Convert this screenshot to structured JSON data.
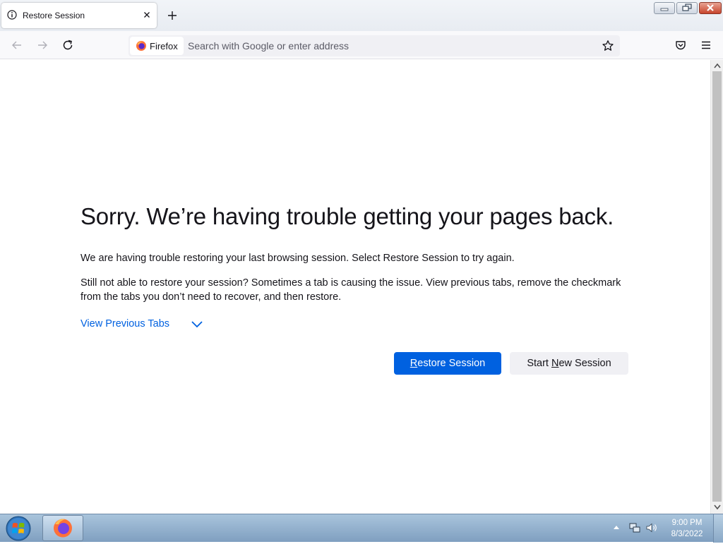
{
  "tab": {
    "title": "Restore Session",
    "icon": "info-icon"
  },
  "nav": {
    "identity_label": "Firefox",
    "url_placeholder": "Search with Google or enter address",
    "url_value": ""
  },
  "content": {
    "heading": "Sorry. We’re having trouble getting your pages back.",
    "paragraph1": "We are having trouble restoring your last browsing session. Select Restore Session to try again.",
    "paragraph2": "Still not able to restore your session? Sometimes a tab is causing the issue. View previous tabs, remove the checkmark from the tabs you don’t need to recover, and then restore.",
    "view_tabs_label": "View Previous Tabs",
    "restore_button": {
      "accesskey": "R",
      "rest": "estore Session"
    },
    "new_session_button": {
      "before": "Start ",
      "accesskey": "N",
      "after": "ew Session"
    }
  },
  "taskbar": {
    "time": "9:00 PM",
    "date": "8/3/2022"
  },
  "colors": {
    "accent": "#0061e0",
    "secondary_button": "#f0f0f4",
    "taskbar": "#8fb0cf"
  }
}
